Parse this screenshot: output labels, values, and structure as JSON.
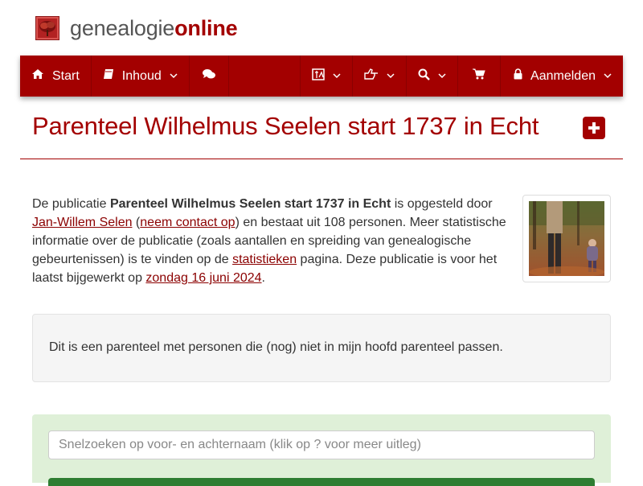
{
  "brand": {
    "name_part1": "genealogie",
    "name_part2": "online"
  },
  "nav": {
    "start": "Start",
    "inhoud": "Inhoud",
    "aanmelden": "Aanmelden"
  },
  "page": {
    "title": "Parenteel Wilhelmus Seelen start 1737 in Echt"
  },
  "intro": {
    "t1": "De publicatie ",
    "pub_name": "Parenteel Wilhelmus Seelen start 1737 in Echt",
    "t2": " is opgesteld door ",
    "author": "Jan-Willem Selen",
    "t3": " (",
    "contact": "neem contact op",
    "t4": ") en bestaat uit 108 personen. Meer statistische informatie over de publicatie (zoals aantallen en spreiding van genealogische gebeurtenissen) is te vinden op de ",
    "stats": "statistieken",
    "t5": " pagina. Deze publicatie is voor het laatst bijgewerkt op ",
    "date": "zondag 16 juni 2024",
    "t6": "."
  },
  "note": {
    "text": "Dit is een parenteel met personen die (nog) niet in mijn hoofd parenteel passen."
  },
  "search": {
    "placeholder": "Snelzoeken op voor- en achternaam (klik op ? voor meer uitleg)"
  },
  "colors": {
    "brand": "#a30000",
    "panel_green": "#dff0d8",
    "button_green": "#2e7d32"
  },
  "icons": [
    "tree-icon",
    "home-icon",
    "book-icon",
    "comments-icon",
    "translate-icon",
    "hand-pointer-icon",
    "search-icon",
    "cart-icon",
    "lock-icon",
    "plus-square-icon"
  ]
}
